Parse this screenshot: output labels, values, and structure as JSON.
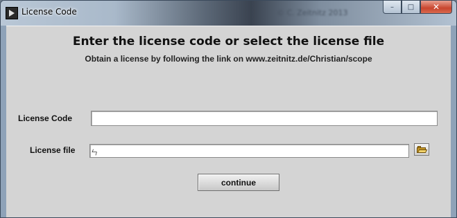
{
  "window": {
    "title": "License Code",
    "title_blur_text": "© C. Zeitnitz 2013",
    "controls": {
      "minimize": "–",
      "maximize": "□",
      "close": "✕"
    }
  },
  "dialog": {
    "heading": "Enter the license code or select the license file",
    "subheading": "Obtain a license by following the link on www.zeitnitz.de/Christian/scope",
    "license_code": {
      "label": "License Code",
      "value": ""
    },
    "license_file": {
      "label": "License file",
      "path_symbol": "ㄣ",
      "value": ""
    },
    "continue_label": "continue"
  },
  "icons": {
    "app": "labview-run-icon",
    "browse": "folder-open-icon"
  },
  "colors": {
    "panel": "#d4d4d4",
    "close_button": "#c8462e"
  }
}
